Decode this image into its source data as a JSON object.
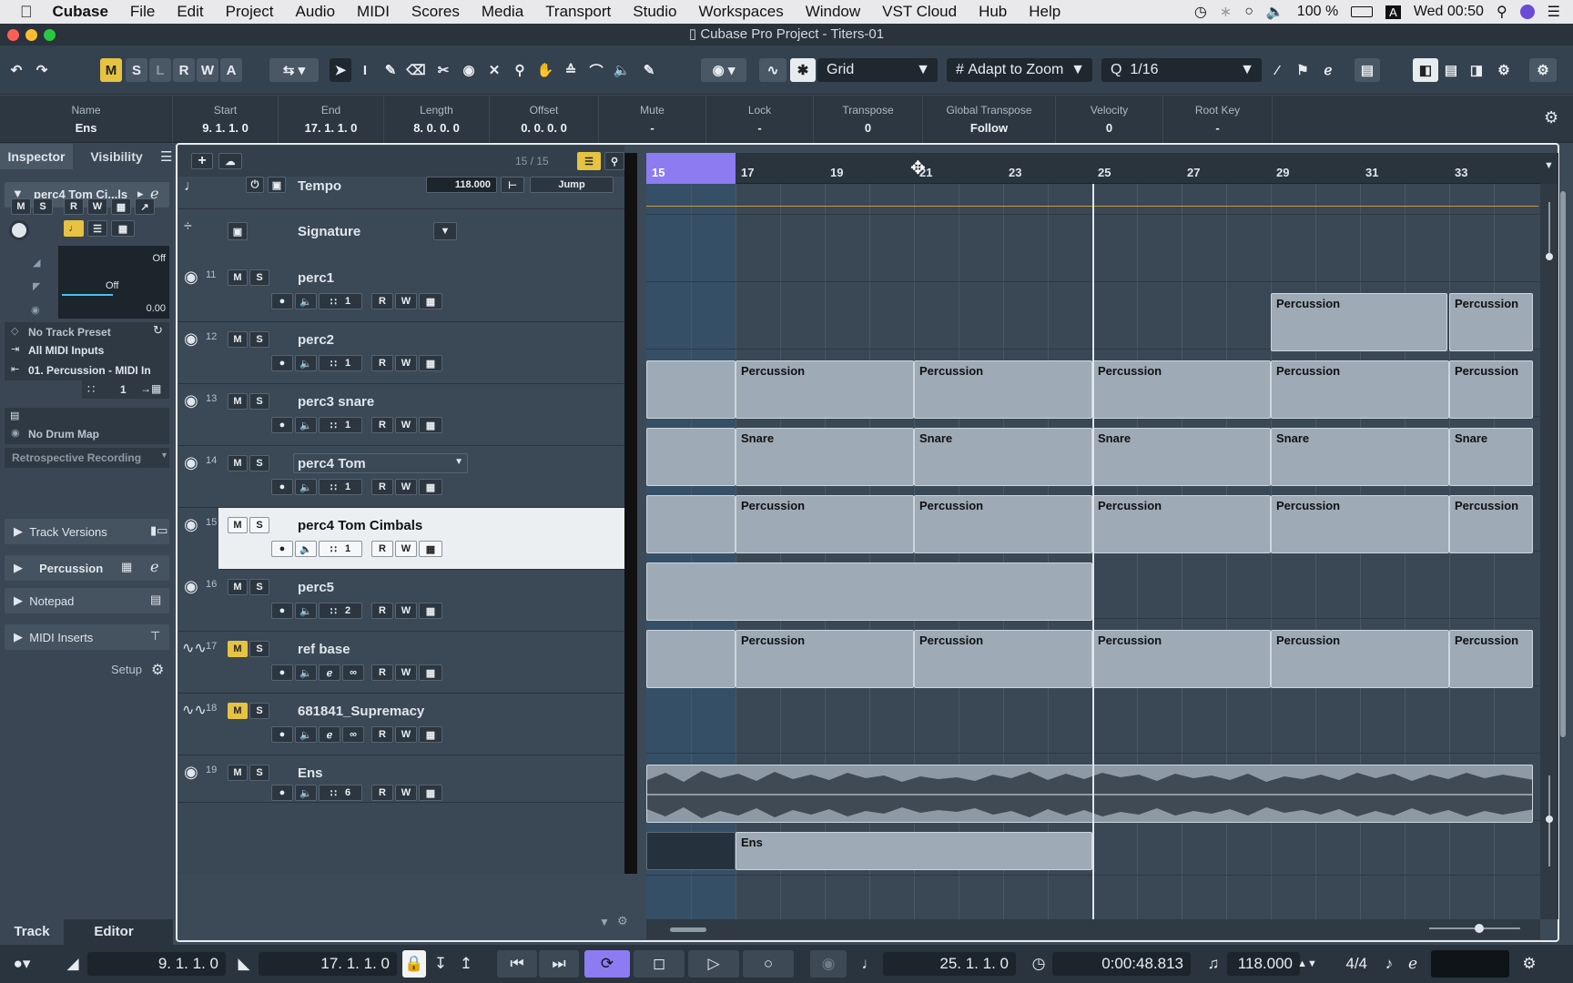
{
  "menubar": {
    "app": "Cubase",
    "items": [
      "File",
      "Edit",
      "Project",
      "Audio",
      "MIDI",
      "Scores",
      "Media",
      "Transport",
      "Studio",
      "Workspaces",
      "Window",
      "VST Cloud",
      "Hub",
      "Help"
    ],
    "battery": "100 %",
    "input_source": "A",
    "clock": "Wed 00:50"
  },
  "window": {
    "title": "Cubase Pro Project - Titers-01"
  },
  "toolbar": {
    "mode_buttons": [
      "M",
      "S",
      "L",
      "R",
      "W",
      "A"
    ],
    "snap_type": "Grid",
    "grid_mode": "Adapt to Zoom",
    "quantize": "1/16"
  },
  "infoline": [
    {
      "header": "Name",
      "value": "Ens"
    },
    {
      "header": "Start",
      "value": "9. 1. 1.   0"
    },
    {
      "header": "End",
      "value": "17. 1. 1.   0"
    },
    {
      "header": "Length",
      "value": "8. 0. 0.   0"
    },
    {
      "header": "Offset",
      "value": "0. 0. 0.   0"
    },
    {
      "header": "Mute",
      "value": "-"
    },
    {
      "header": "Lock",
      "value": "-"
    },
    {
      "header": "Transpose",
      "value": "0"
    },
    {
      "header": "Global Transpose",
      "value": "Follow"
    },
    {
      "header": "Velocity",
      "value": "0"
    },
    {
      "header": "Root Key",
      "value": "-"
    }
  ],
  "inspector": {
    "tabs": [
      "Inspector",
      "Visibility"
    ],
    "track_name": "perc4 Tom Ci...ls",
    "mini_buttons": [
      "M",
      "S",
      "R",
      "W"
    ],
    "volume": "Off",
    "pan": "Off",
    "delay": "0.00",
    "preset": "No Track Preset",
    "input": "All MIDI Inputs",
    "output": "01. Percussion - MIDI In",
    "channel": "1",
    "drum_map": "No Drum Map",
    "retro": "Retrospective Recording",
    "sections": [
      "Track Versions",
      "Percussion",
      "Notepad",
      "MIDI Inserts"
    ],
    "setup": "Setup",
    "bottom_tabs": [
      "Track",
      "Editor"
    ]
  },
  "tracklist": {
    "count": "15 / 15",
    "tempo": {
      "label": "Tempo",
      "value": "118.000",
      "mode": "Jump"
    },
    "signature": {
      "label": "Signature"
    },
    "tracks": [
      {
        "num": "11",
        "name": "perc1",
        "ch": "1"
      },
      {
        "num": "12",
        "name": "perc2",
        "ch": "1"
      },
      {
        "num": "13",
        "name": "perc3 snare",
        "ch": "1"
      },
      {
        "num": "14",
        "name": "perc4 Tom",
        "ch": "1"
      },
      {
        "num": "15",
        "name": "perc4 Tom Cimbals",
        "ch": "1"
      },
      {
        "num": "16",
        "name": "perc5",
        "ch": "2"
      },
      {
        "num": "17",
        "name": "ref base",
        "ch": ""
      },
      {
        "num": "18",
        "name": "681841_Supremacy",
        "ch": ""
      },
      {
        "num": "19",
        "name": "Ens",
        "ch": "6"
      }
    ]
  },
  "ruler": {
    "bars": [
      "15",
      "17",
      "19",
      "21",
      "23",
      "25",
      "27",
      "29",
      "31",
      "33"
    ]
  },
  "events": {
    "percussion": "Percussion",
    "snare": "Snare",
    "ens": "Ens"
  },
  "transport": {
    "left_locator": "9.  1.  1.    0",
    "right_locator": "17.  1.  1.    0",
    "position": "25.  1.  1.    0",
    "time": "0:00:48.813",
    "tempo": "118.000",
    "signature": "4/4"
  },
  "colors": {
    "accent": "#e6c341",
    "selection": "#8d7bf2",
    "event": "#9eaab5"
  }
}
